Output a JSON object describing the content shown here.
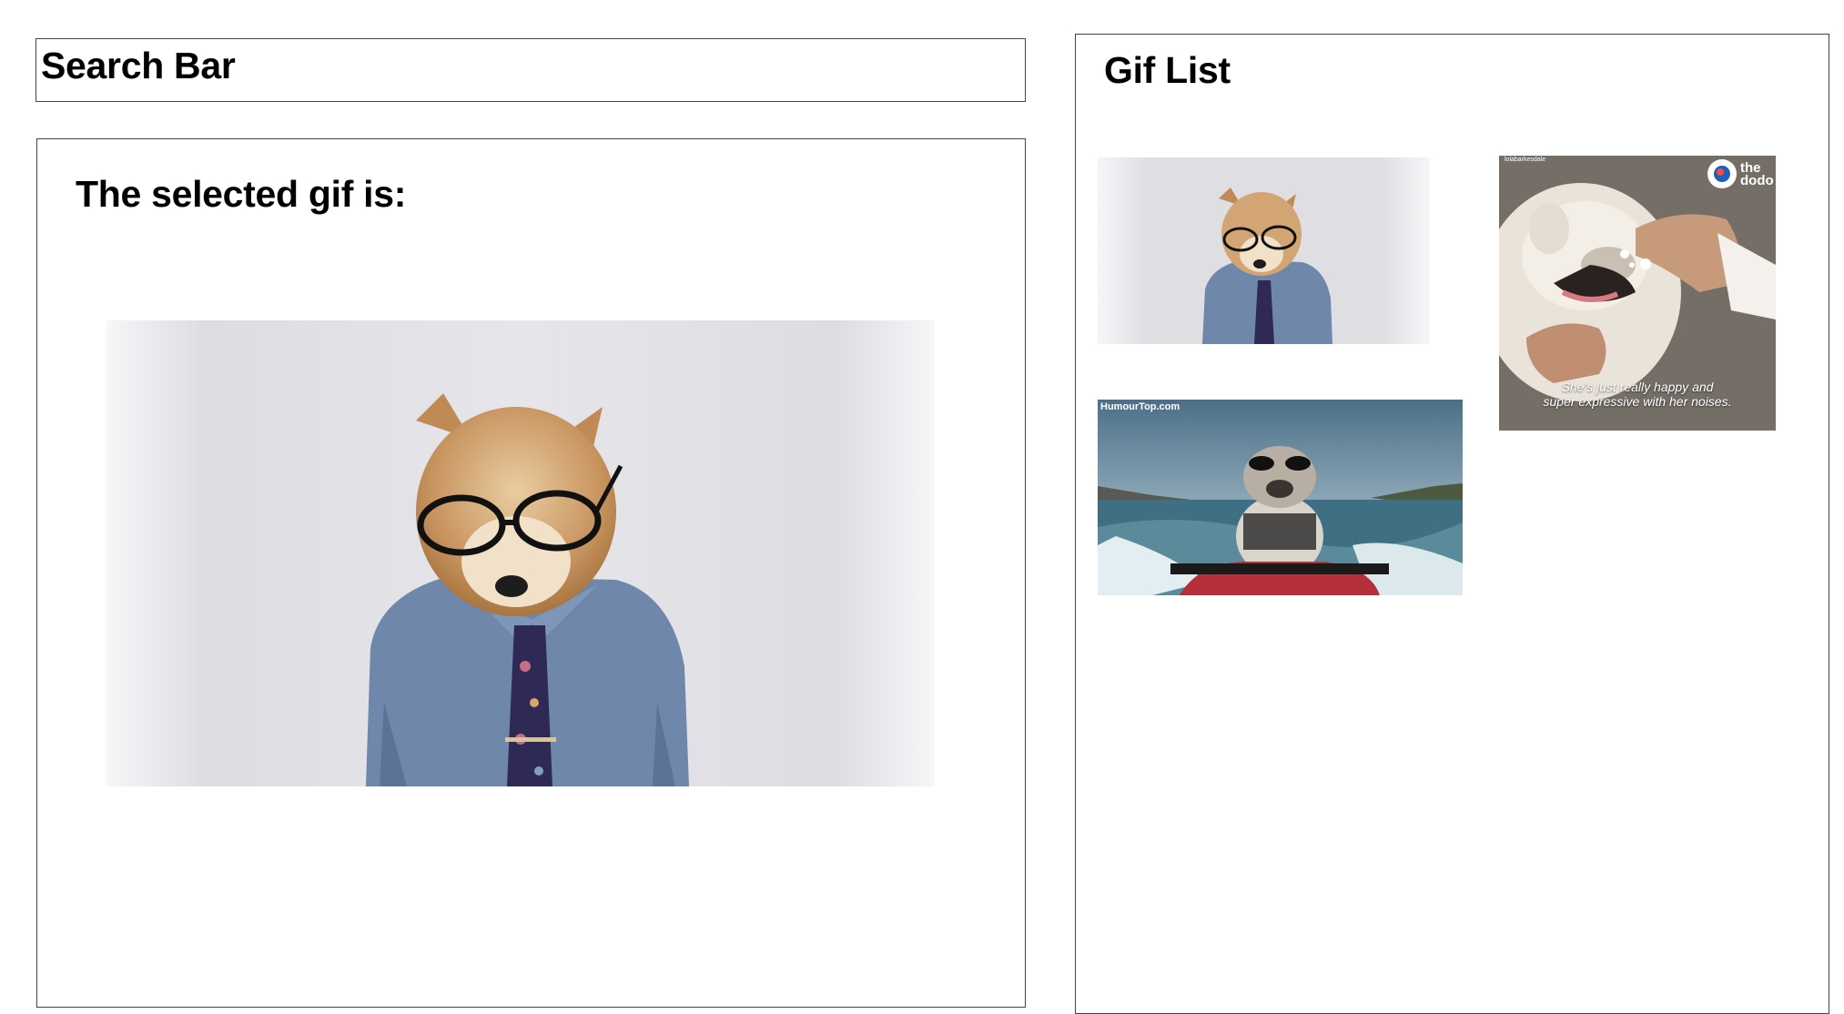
{
  "search": {
    "title": "Search Bar"
  },
  "detail": {
    "heading": "The selected gif is:",
    "selected_gif_subject": "shiba-dog-in-glasses-shirt-tie"
  },
  "gif_list": {
    "heading": "Gif List",
    "items": [
      {
        "subject": "shiba-dog-in-glasses-shirt-tie",
        "watermark": "",
        "caption": ""
      },
      {
        "subject": "french-bulldog-being-tickled",
        "watermark": "the dodo",
        "handle": "lolabarkesdale",
        "caption_line1": "She's just really happy and",
        "caption_line2": "super expressive with her noises."
      },
      {
        "subject": "bulldog-on-jet-ski",
        "watermark": "HumourTop.com"
      }
    ]
  }
}
